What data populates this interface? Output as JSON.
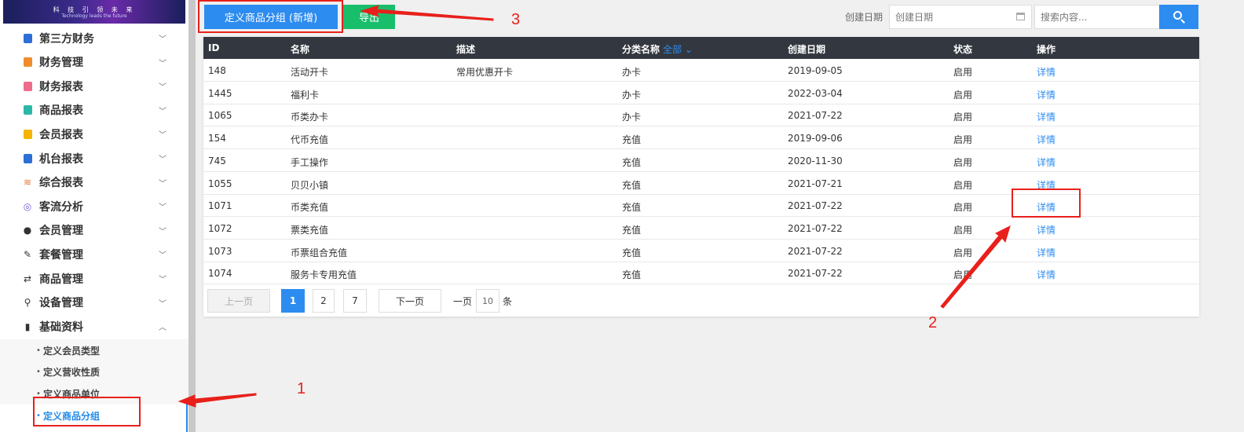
{
  "logo": {
    "line1": "科 技 引 领 未 来",
    "line2": "Technology leads the future"
  },
  "sidebar": {
    "items": [
      {
        "label": "第三方财务",
        "icon": "calculator-icon",
        "color": "#2d6fd6"
      },
      {
        "label": "财务管理",
        "icon": "ledger-icon",
        "color": "#f08c2b"
      },
      {
        "label": "财务报表",
        "icon": "report-icon",
        "color": "#ee6b8a"
      },
      {
        "label": "商品报表",
        "icon": "goods-report-icon",
        "color": "#2bb7a8"
      },
      {
        "label": "会员报表",
        "icon": "member-report-icon",
        "color": "#f4b400"
      },
      {
        "label": "机台报表",
        "icon": "machine-report-icon",
        "color": "#2d6fd6"
      },
      {
        "label": "综合报表",
        "icon": "layers-icon",
        "color": "#e8702a"
      },
      {
        "label": "客流分析",
        "icon": "target-icon",
        "color": "#7a5cd6"
      },
      {
        "label": "会员管理",
        "icon": "user-icon",
        "color": "#333333"
      },
      {
        "label": "套餐管理",
        "icon": "edit-icon",
        "color": "#333333"
      },
      {
        "label": "商品管理",
        "icon": "exchange-icon",
        "color": "#333333"
      },
      {
        "label": "设备管理",
        "icon": "wrench-icon",
        "color": "#333333"
      },
      {
        "label": "基础资料",
        "icon": "document-icon",
        "color": "#333333"
      }
    ],
    "subitems": [
      "定义会员类型",
      "定义营收性质",
      "定义商品单位",
      "定义商品分组"
    ],
    "active_subitem": "定义商品分组"
  },
  "toolbar": {
    "add_label": "定义商品分组 (新增)",
    "export_label": "导出",
    "date_label": "创建日期",
    "date_placeholder": "创建日期",
    "search_placeholder": "搜索内容..."
  },
  "table": {
    "columns": {
      "id": "ID",
      "name": "名称",
      "desc": "描述",
      "category": "分类名称",
      "category_filter": "全部",
      "date": "创建日期",
      "status": "状态",
      "action": "操作"
    },
    "rows": [
      {
        "id": "148",
        "name": "活动开卡",
        "desc": "常用优惠开卡",
        "category": "办卡",
        "date": "2019-09-05",
        "status": "启用",
        "action": "详情"
      },
      {
        "id": "1445",
        "name": "福利卡",
        "desc": "",
        "category": "办卡",
        "date": "2022-03-04",
        "status": "启用",
        "action": "详情"
      },
      {
        "id": "1065",
        "name": "币类办卡",
        "desc": "",
        "category": "办卡",
        "date": "2021-07-22",
        "status": "启用",
        "action": "详情"
      },
      {
        "id": "154",
        "name": "代币充值",
        "desc": "",
        "category": "充值",
        "date": "2019-09-06",
        "status": "启用",
        "action": "详情"
      },
      {
        "id": "745",
        "name": "手工操作",
        "desc": "",
        "category": "充值",
        "date": "2020-11-30",
        "status": "启用",
        "action": "详情"
      },
      {
        "id": "1055",
        "name": "贝贝小镇",
        "desc": "",
        "category": "充值",
        "date": "2021-07-21",
        "status": "启用",
        "action": "详情"
      },
      {
        "id": "1071",
        "name": "币类充值",
        "desc": "",
        "category": "充值",
        "date": "2021-07-22",
        "status": "启用",
        "action": "详情"
      },
      {
        "id": "1072",
        "name": "票类充值",
        "desc": "",
        "category": "充值",
        "date": "2021-07-22",
        "status": "启用",
        "action": "详情"
      },
      {
        "id": "1073",
        "name": "币票组合充值",
        "desc": "",
        "category": "充值",
        "date": "2021-07-22",
        "status": "启用",
        "action": "详情"
      },
      {
        "id": "1074",
        "name": "服务卡专用充值",
        "desc": "",
        "category": "充值",
        "date": "2021-07-22",
        "status": "启用",
        "action": "详情"
      }
    ]
  },
  "pagination": {
    "prev": "上一页",
    "pages": [
      "1",
      "2",
      "7"
    ],
    "current": "1",
    "next": "下一页",
    "per_page_prefix": "一页",
    "per_page_value": "10",
    "per_page_suffix": "条"
  },
  "annotations": {
    "n1": "1",
    "n2": "2",
    "n3": "3",
    "color": "#e8201b"
  }
}
